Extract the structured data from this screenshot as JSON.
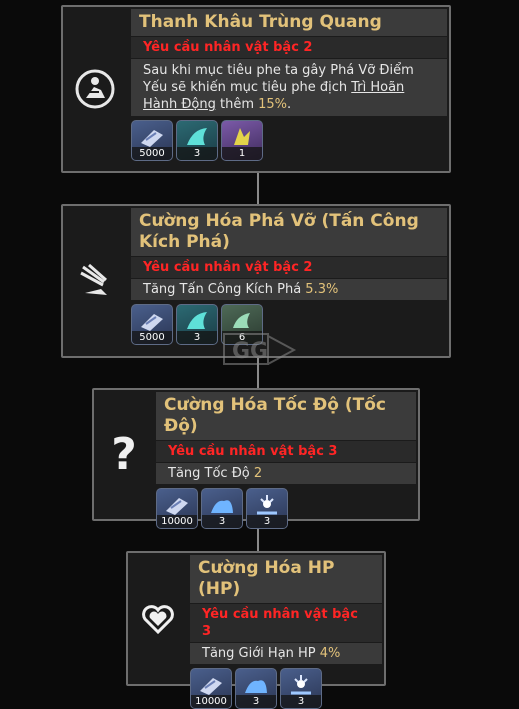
{
  "cards": [
    {
      "title": "Thanh Khâu Trùng Quang",
      "requirement": "Yêu cầu nhân vật bậc 2",
      "desc_l1": "Sau khi mục tiêu phe ta gây Phá Vỡ Điểm",
      "desc_l2a": "Yếu sẽ khiến mục tiêu phe địch ",
      "desc_l2b": "Trì Hoãn",
      "desc_l3a": "Hành Động",
      "desc_l3b": " thêm ",
      "desc_l3c": "15%",
      "desc_l3d": ".",
      "icon": "person-circle-icon",
      "materials": [
        {
          "count": "5000",
          "icon": "credit-icon"
        },
        {
          "count": "3",
          "icon": "teal-material-icon"
        },
        {
          "count": "1",
          "icon": "purple-material-icon"
        }
      ]
    },
    {
      "title_l1": "Cường Hóa Phá Vỡ (Tấn Công",
      "title_l2": "Kích Phá)",
      "requirement": "Yêu cầu nhân vật bậc 2",
      "desc_a": "Tăng Tấn Công Kích Phá ",
      "desc_b": "5.3%",
      "icon": "break-burst-icon",
      "materials": [
        {
          "count": "5000",
          "icon": "credit-icon"
        },
        {
          "count": "3",
          "icon": "teal-material-icon"
        },
        {
          "count": "6",
          "icon": "green-material-icon"
        }
      ]
    },
    {
      "title": "Cường Hóa Tốc Độ (Tốc Độ)",
      "requirement": "Yêu cầu nhân vật bậc 3",
      "desc_a": "Tăng Tốc Độ ",
      "desc_b": "2",
      "icon": "question-mark-icon",
      "glyph": "?",
      "materials": [
        {
          "count": "10000",
          "icon": "credit-icon"
        },
        {
          "count": "3",
          "icon": "blue-material-icon"
        },
        {
          "count": "3",
          "icon": "spark-material-icon"
        }
      ]
    },
    {
      "title": "Cường Hóa HP (HP)",
      "requirement": "Yêu cầu nhân vật bậc 3",
      "desc_a": "Tăng Giới Hạn HP ",
      "desc_b": "4%",
      "icon": "heart-icon",
      "materials": [
        {
          "count": "10000",
          "icon": "credit-icon"
        },
        {
          "count": "3",
          "icon": "blue-material-icon"
        },
        {
          "count": "3",
          "icon": "spark-material-icon"
        }
      ]
    }
  ],
  "colors": {
    "title_gold": "#e2c27a",
    "requirement_red": "#ff2525",
    "highlight": "#e2c27a"
  }
}
